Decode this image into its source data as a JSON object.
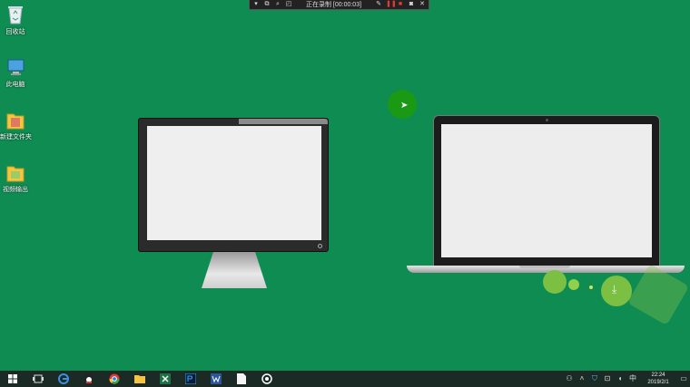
{
  "desktop": {
    "icons": [
      {
        "label": "回收站",
        "icon": "recycle-bin-icon"
      },
      {
        "label": "此电脑",
        "icon": "computer-icon"
      },
      {
        "label": "新建文件夹",
        "icon": "folder-icon"
      },
      {
        "label": "视频输出",
        "icon": "folder-icon"
      }
    ]
  },
  "recorder": {
    "status_text": "正在录制 [00:00:03]"
  },
  "taskbar": {
    "apps": [
      "start-icon",
      "task-view-icon",
      "edge-icon",
      "qq-icon",
      "chrome-icon",
      "file-explorer-icon",
      "excel-icon",
      "photoshop-icon",
      "word-icon",
      "blank-document-icon",
      "recorder-app-icon"
    ],
    "tray": {
      "ime": "中",
      "time": "22:24",
      "date": "2019/2/1"
    }
  },
  "colors": {
    "desktop_bg": "#0e8c52",
    "recording_red": "#e53935",
    "taskbar_bg": "#1c2a26"
  }
}
